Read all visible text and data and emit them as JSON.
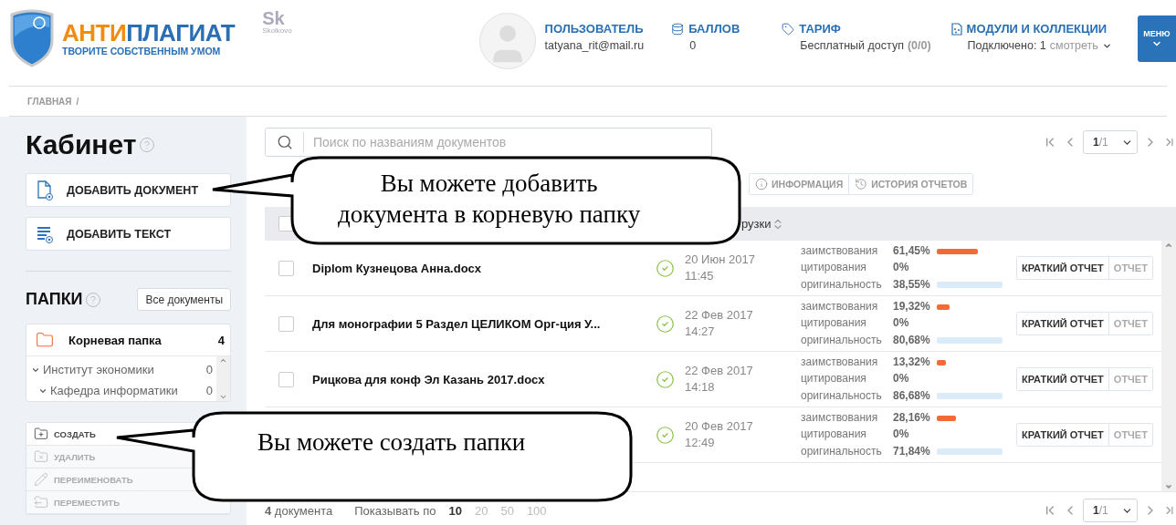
{
  "header": {
    "logo": {
      "title_a": "АНТИ",
      "title_b": "ПЛАГИАТ",
      "slogan": "ТВОРИТЕ СОБСТВЕННЫМ УМОМ"
    },
    "partner_logo": {
      "mark": "Sk",
      "name": "Skolkovo"
    },
    "user": {
      "label": "ПОЛЬЗОВАТЕЛЬ",
      "email": "tatyana_rit@mail.ru"
    },
    "points": {
      "label": "БАЛЛОВ",
      "value": "0"
    },
    "tariff": {
      "label": "ТАРИФ",
      "value": "Бесплатный доступ",
      "quota": "(0/0)"
    },
    "modules": {
      "label": "МОДУЛИ И КОЛЛЕКЦИИ",
      "value": "Подключено: 1",
      "link": "смотреть"
    },
    "menu_button": "МЕНЮ"
  },
  "breadcrumb": {
    "items": [
      "ГЛАВНАЯ"
    ],
    "separator": "/"
  },
  "sidebar": {
    "title": "Кабинет",
    "actions": [
      {
        "label": "ДОБАВИТЬ ДОКУМЕНТ",
        "kind": "document"
      },
      {
        "label": "ДОБАВИТЬ ТЕКСТ",
        "kind": "text"
      }
    ],
    "folders_title": "ПАПКИ",
    "all_docs_button": "Все документы",
    "root_folder": {
      "name": "Корневая папка",
      "count": "4"
    },
    "tree": [
      {
        "name": "Институт экономики",
        "count": "0",
        "expanded": true,
        "children": [
          {
            "name": "Кафедра информатики",
            "count": "0",
            "expanded": true
          }
        ]
      }
    ],
    "folder_actions": [
      {
        "label": "СОЗДАТЬ",
        "kind": "create",
        "disabled": false
      },
      {
        "label": "УДАЛИТЬ",
        "kind": "delete",
        "disabled": true
      },
      {
        "label": "ПЕРЕИМЕНОВАТЬ",
        "kind": "rename",
        "disabled": true
      },
      {
        "label": "ПЕРЕМЕСТИТЬ",
        "kind": "move",
        "disabled": true
      }
    ]
  },
  "main": {
    "search": {
      "placeholder": "Поиск по названиям документов"
    },
    "pager": {
      "page": "1",
      "total": "/1"
    },
    "toolbar": [
      {
        "label": "ИНФОРМАЦИЯ",
        "kind": "info"
      },
      {
        "label": "ИСТОРИЯ ОТЧЕТОВ",
        "kind": "history"
      }
    ],
    "table": {
      "select_all": {
        "checked": false
      },
      "column_date": "рузки",
      "rows": [
        {
          "name": "Diplom Кузнецова Анна.docx",
          "checked": false,
          "date": "20 Июн 2017",
          "time": "11:45",
          "metrics": [
            {
              "kind": "borrow",
              "label": "заимствования",
              "value": "61,45%"
            },
            {
              "kind": "cite",
              "label": "цитирования",
              "value": "0%"
            },
            {
              "kind": "original",
              "label": "оригинальность",
              "value": "38,55%"
            }
          ],
          "buttons": [
            "КРАТКИЙ ОТЧЕТ",
            "ОТЧЕТ"
          ]
        },
        {
          "name": "Для монографии 5 Раздел ЦЕЛИКОМ Орг-ция У...",
          "checked": false,
          "date": "22 Фев 2017",
          "time": "14:27",
          "metrics": [
            {
              "kind": "borrow",
              "label": "заимствования",
              "value": "19,32%"
            },
            {
              "kind": "cite",
              "label": "цитирования",
              "value": "0%"
            },
            {
              "kind": "original",
              "label": "оригинальность",
              "value": "80,68%"
            }
          ],
          "buttons": [
            "КРАТКИЙ ОТЧЕТ",
            "ОТЧЕТ"
          ]
        },
        {
          "name": "Рицкова для конф Эл Казань 2017.docx",
          "checked": false,
          "date": "22 Фев 2017",
          "time": "14:18",
          "metrics": [
            {
              "kind": "borrow",
              "label": "заимствования",
              "value": "13,32%"
            },
            {
              "kind": "cite",
              "label": "цитирования",
              "value": "0%"
            },
            {
              "kind": "original",
              "label": "оригинальность",
              "value": "86,68%"
            }
          ],
          "buttons": [
            "КРАТКИЙ ОТЧЕТ",
            "ОТЧЕТ"
          ]
        },
        {
          "date": "20 Фев 2017",
          "time": "12:49",
          "metrics": [
            {
              "kind": "borrow",
              "label": "заимствования",
              "value": "28,16%"
            },
            {
              "kind": "cite",
              "label": "цитирования",
              "value": "0%"
            },
            {
              "kind": "original",
              "label": "оригинальность",
              "value": "71,84%"
            }
          ],
          "buttons": [
            "КРАТКИЙ ОТЧЕТ",
            "ОТЧЕТ"
          ]
        }
      ]
    },
    "footer": {
      "count": "**4** документа",
      "per_page_label": "Показывать по",
      "per_page": [
        {
          "label": "10",
          "selected": true
        },
        {
          "label": "20",
          "selected": false
        },
        {
          "label": "50",
          "selected": false
        },
        {
          "label": "100",
          "selected": false
        }
      ],
      "pager": {
        "page": "1",
        "total": "/1"
      }
    }
  },
  "callouts": [
    {
      "kind": "document",
      "text": "Вы можете добавить\nдокумента в корневую папку"
    },
    {
      "kind": "folder",
      "text": "Вы можете создать папки"
    }
  ]
}
